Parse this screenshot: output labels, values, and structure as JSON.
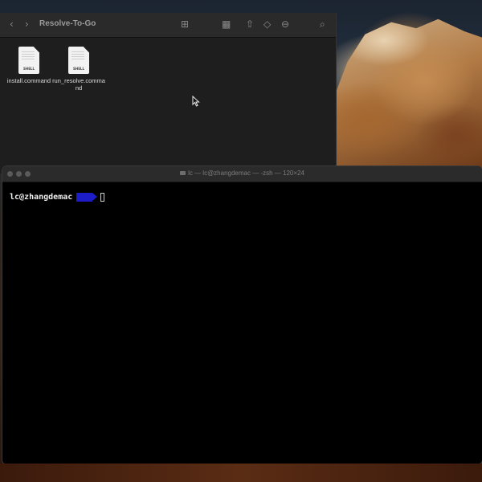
{
  "finder": {
    "title": "Resolve-To-Go",
    "toolbar": {
      "back": "‹",
      "forward": "›",
      "view": "⊞",
      "group": "▦",
      "share": "⇧",
      "tag": "◇",
      "action": "⊖",
      "search": "⌕"
    },
    "files": [
      {
        "name": "install.command",
        "type_label": "SHELL"
      },
      {
        "name": "run_resolve.command",
        "type_label": "SHELL"
      }
    ]
  },
  "terminal": {
    "title": "lc — lc@zhangdemac — -zsh — 120×24",
    "prompt_user": "lc@zhangdemac",
    "prompt_color": "#1d1dc7"
  },
  "cursor_icon": "arrow-pointer-icon"
}
